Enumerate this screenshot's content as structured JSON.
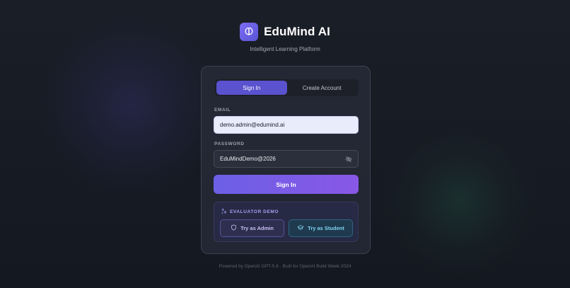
{
  "brand": {
    "name": "EduMind AI",
    "tagline": "Intelligent Learning Platform",
    "logo_icon": "brain-icon",
    "accent": "#6c60e6"
  },
  "tabs": [
    {
      "label": "Sign In",
      "active": true
    },
    {
      "label": "Create Account",
      "active": false
    }
  ],
  "form": {
    "email_label": "EMAIL",
    "email_value": "demo.admin@edumind.ai",
    "password_label": "PASSWORD",
    "password_value": "EduMindDemo@2026",
    "password_toggle_icon": "eye-off-icon",
    "submit_label": "Sign In"
  },
  "demo": {
    "title": "EVALUATOR DEMO",
    "title_icon": "sparkle-icon",
    "admin_label": "Try as Admin",
    "admin_icon": "shield-icon",
    "student_label": "Try as Student",
    "student_icon": "graduation-cap-icon"
  },
  "footer": "Powered by OpenAI GPT-5.6 · Built for OpenAI Build Week 2024"
}
